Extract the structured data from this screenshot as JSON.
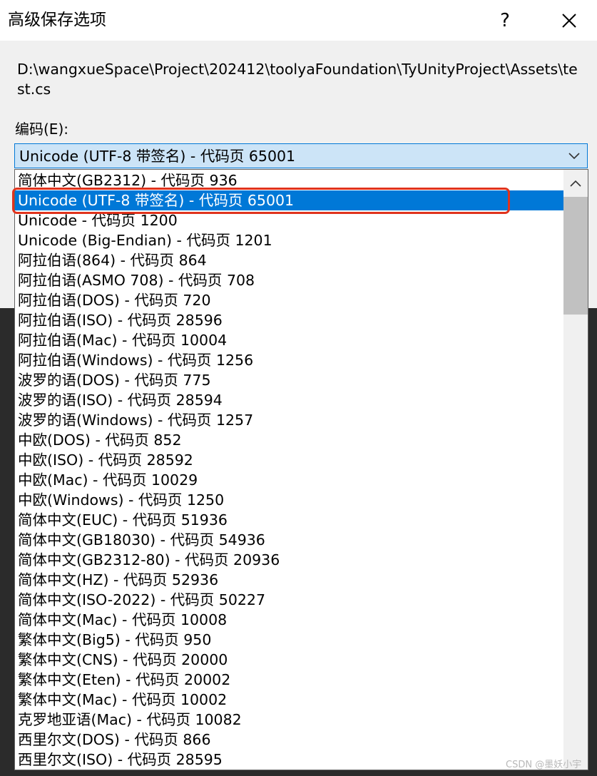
{
  "window": {
    "title": "高级保存选项",
    "help_label": "?",
    "close_label": "✕"
  },
  "file_path": "D:\\wangxueSpace\\Project\\202412\\toolyaFoundation\\TyUnityProject\\Assets\\test.cs",
  "encoding": {
    "label": "编码(E):",
    "selected": "Unicode (UTF-8 带签名) - 代码页 65001",
    "options": [
      "简体中文(GB2312) - 代码页 936",
      "Unicode (UTF-8 带签名) - 代码页 65001",
      "Unicode - 代码页 1200",
      "Unicode (Big-Endian) - 代码页 1201",
      "阿拉伯语(864) - 代码页 864",
      "阿拉伯语(ASMO 708) - 代码页 708",
      "阿拉伯语(DOS) - 代码页 720",
      "阿拉伯语(ISO) - 代码页 28596",
      "阿拉伯语(Mac) - 代码页 10004",
      "阿拉伯语(Windows) - 代码页 1256",
      "波罗的语(DOS) - 代码页 775",
      "波罗的语(ISO) - 代码页 28594",
      "波罗的语(Windows) - 代码页 1257",
      "中欧(DOS) - 代码页 852",
      "中欧(ISO) - 代码页 28592",
      "中欧(Mac) - 代码页 10029",
      "中欧(Windows) - 代码页 1250",
      "简体中文(EUC) - 代码页 51936",
      "简体中文(GB18030) - 代码页 54936",
      "简体中文(GB2312-80) - 代码页 20936",
      "简体中文(HZ) - 代码页 52936",
      "简体中文(ISO-2022) - 代码页 50227",
      "简体中文(Mac) - 代码页 10008",
      "繁体中文(Big5) - 代码页 950",
      "繁体中文(CNS) - 代码页 20000",
      "繁体中文(Eten) - 代码页 20002",
      "繁体中文(Mac) - 代码页 10002",
      "克罗地亚语(Mac) - 代码页 10082",
      "西里尔文(DOS) - 代码页 866",
      "西里尔文(ISO) - 代码页 28595"
    ],
    "highlighted_index": 1
  },
  "icons": {
    "combo_arrow": "chevron-down-icon",
    "scroll_up": "chevron-up-icon"
  },
  "colors": {
    "selection": "#0078d7",
    "annotation_box": "#e0331d",
    "combo_background": "#cce4f7"
  },
  "watermark": "CSDN @墨妖小宇"
}
